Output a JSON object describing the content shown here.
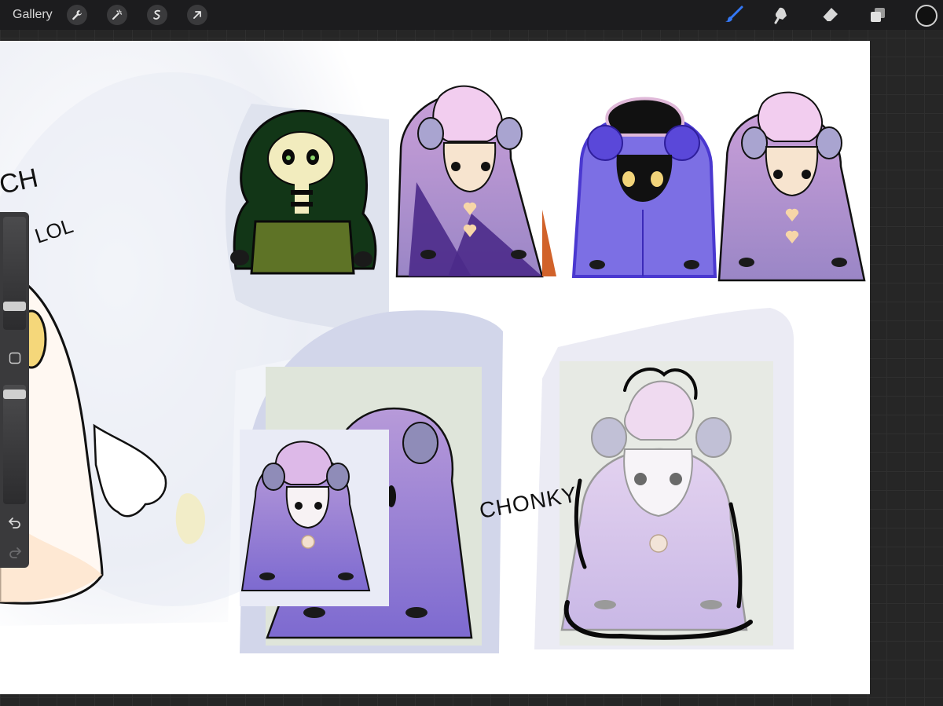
{
  "toolbar": {
    "gallery_label": "Gallery",
    "left_tools": [
      "wrench-icon",
      "magic-wand-icon",
      "selection-icon",
      "transform-arrow-icon"
    ],
    "right_tools": [
      "brush-icon",
      "smudge-icon",
      "eraser-icon",
      "layers-icon"
    ],
    "active_tool": "brush-icon",
    "accent_color": "#3478f6",
    "current_color": "#111111"
  },
  "sidebar": {
    "controls": [
      "brush-size-slider",
      "modify-button",
      "opacity-slider",
      "undo-icon",
      "redo-icon"
    ]
  },
  "canvas": {
    "handwritten_text": {
      "left_partial_1": "CH",
      "left_partial_2": "LOL",
      "chonky": "CHONKY"
    }
  }
}
